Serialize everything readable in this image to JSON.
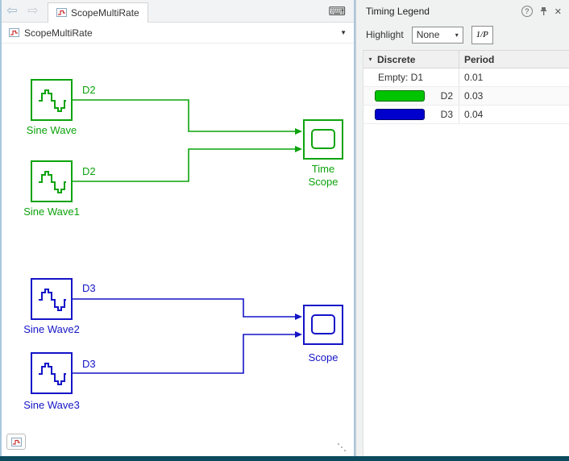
{
  "colors": {
    "green": "#0ca30c",
    "blue": "#1414c8",
    "swatch_green": "#00c400",
    "swatch_blue": "#0000cc",
    "frame_blue": "#a9c7dd",
    "bottom_edge": "#0c4a5e"
  },
  "editor": {
    "toolbar": {
      "back_icon": "⇦",
      "forward_icon": "⇨",
      "tab_label": "ScopeMultiRate",
      "keyboard_icon": "⌨"
    },
    "breadcrumb": {
      "label": "ScopeMultiRate",
      "caret": "▼"
    },
    "blocks": [
      {
        "label": "Sine Wave",
        "rate": "D2"
      },
      {
        "label": "Sine Wave1",
        "rate": "D2"
      },
      {
        "label": "Time Scope"
      },
      {
        "label": "Sine Wave2",
        "rate": "D3"
      },
      {
        "label": "Sine Wave3",
        "rate": "D3"
      },
      {
        "label": "Scope"
      }
    ]
  },
  "panel": {
    "title": "Timing Legend",
    "icons": {
      "help": "?",
      "close": "✕"
    },
    "highlight_label": "Highlight",
    "highlight_value": "None",
    "dropdown_caret": "▾",
    "period_toggle": "1/P",
    "table": {
      "collapse_icon": "▾",
      "group_header": "Discrete",
      "period_header": "Period",
      "rows": [
        {
          "label": "Empty: D1",
          "period": "0.01"
        },
        {
          "label": "D2",
          "period": "0.03",
          "swatch": "#00c400"
        },
        {
          "label": "D3",
          "period": "0.04",
          "swatch": "#0000cc"
        }
      ]
    }
  }
}
